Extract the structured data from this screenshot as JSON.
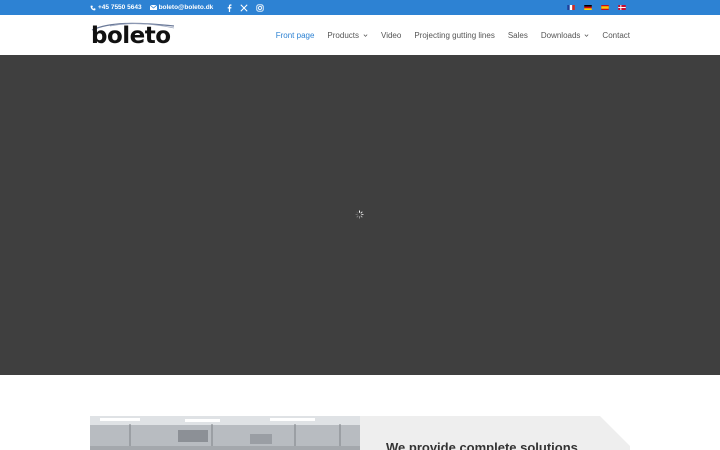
{
  "topbar": {
    "phone": "+45 7550 5643",
    "email": "boleto@boleto.dk",
    "social": [
      "facebook-icon",
      "x-icon",
      "instagram-icon"
    ],
    "languages": [
      "fr",
      "de",
      "es",
      "dk"
    ],
    "color": "#2d82d3"
  },
  "header": {
    "logo_text": "boleto",
    "nav": [
      {
        "label": "Front page",
        "active": true,
        "dropdown": false
      },
      {
        "label": "Products",
        "active": false,
        "dropdown": true
      },
      {
        "label": "Video",
        "active": false,
        "dropdown": false
      },
      {
        "label": "Projecting gutting lines",
        "active": false,
        "dropdown": false
      },
      {
        "label": "Sales",
        "active": false,
        "dropdown": false
      },
      {
        "label": "Downloads",
        "active": false,
        "dropdown": true
      },
      {
        "label": "Contact",
        "active": false,
        "dropdown": false
      }
    ]
  },
  "hero": {
    "background": "#3f3f3f",
    "loader": "spinner-icon"
  },
  "section": {
    "headline": "We provide complete solutions"
  }
}
